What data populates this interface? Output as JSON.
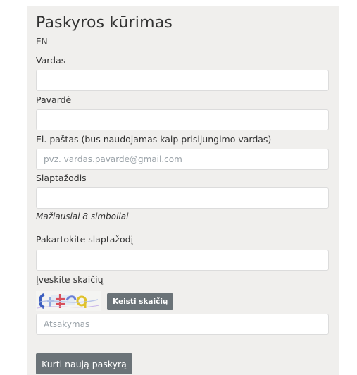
{
  "page": {
    "title": "Paskyros kūrimas",
    "language_link": "EN"
  },
  "form": {
    "first_name": {
      "label": "Vardas",
      "value": "",
      "placeholder": ""
    },
    "last_name": {
      "label": "Pavardė",
      "value": "",
      "placeholder": ""
    },
    "email": {
      "label": "El. paštas (bus naudojamas kaip prisijungimo vardas)",
      "value": "",
      "placeholder": "pvz. vardas.pavardė@gmail.com"
    },
    "password": {
      "label": "Slaptažodis",
      "value": "",
      "placeholder": "",
      "hint": "Mažiausiai 8 simboliai"
    },
    "password_repeat": {
      "label": "Pakartokite slaptažodį",
      "value": "",
      "placeholder": ""
    },
    "captcha": {
      "label": "Įveskite skaičių",
      "refresh_label": "Keisti skaičių",
      "answer_placeholder": "Atsakymas",
      "answer_value": ""
    },
    "submit_label": "Kurti naują paskyrą"
  },
  "colors": {
    "background": "#f0efed",
    "button": "#6b7378",
    "link_underline": "#d9534f"
  }
}
